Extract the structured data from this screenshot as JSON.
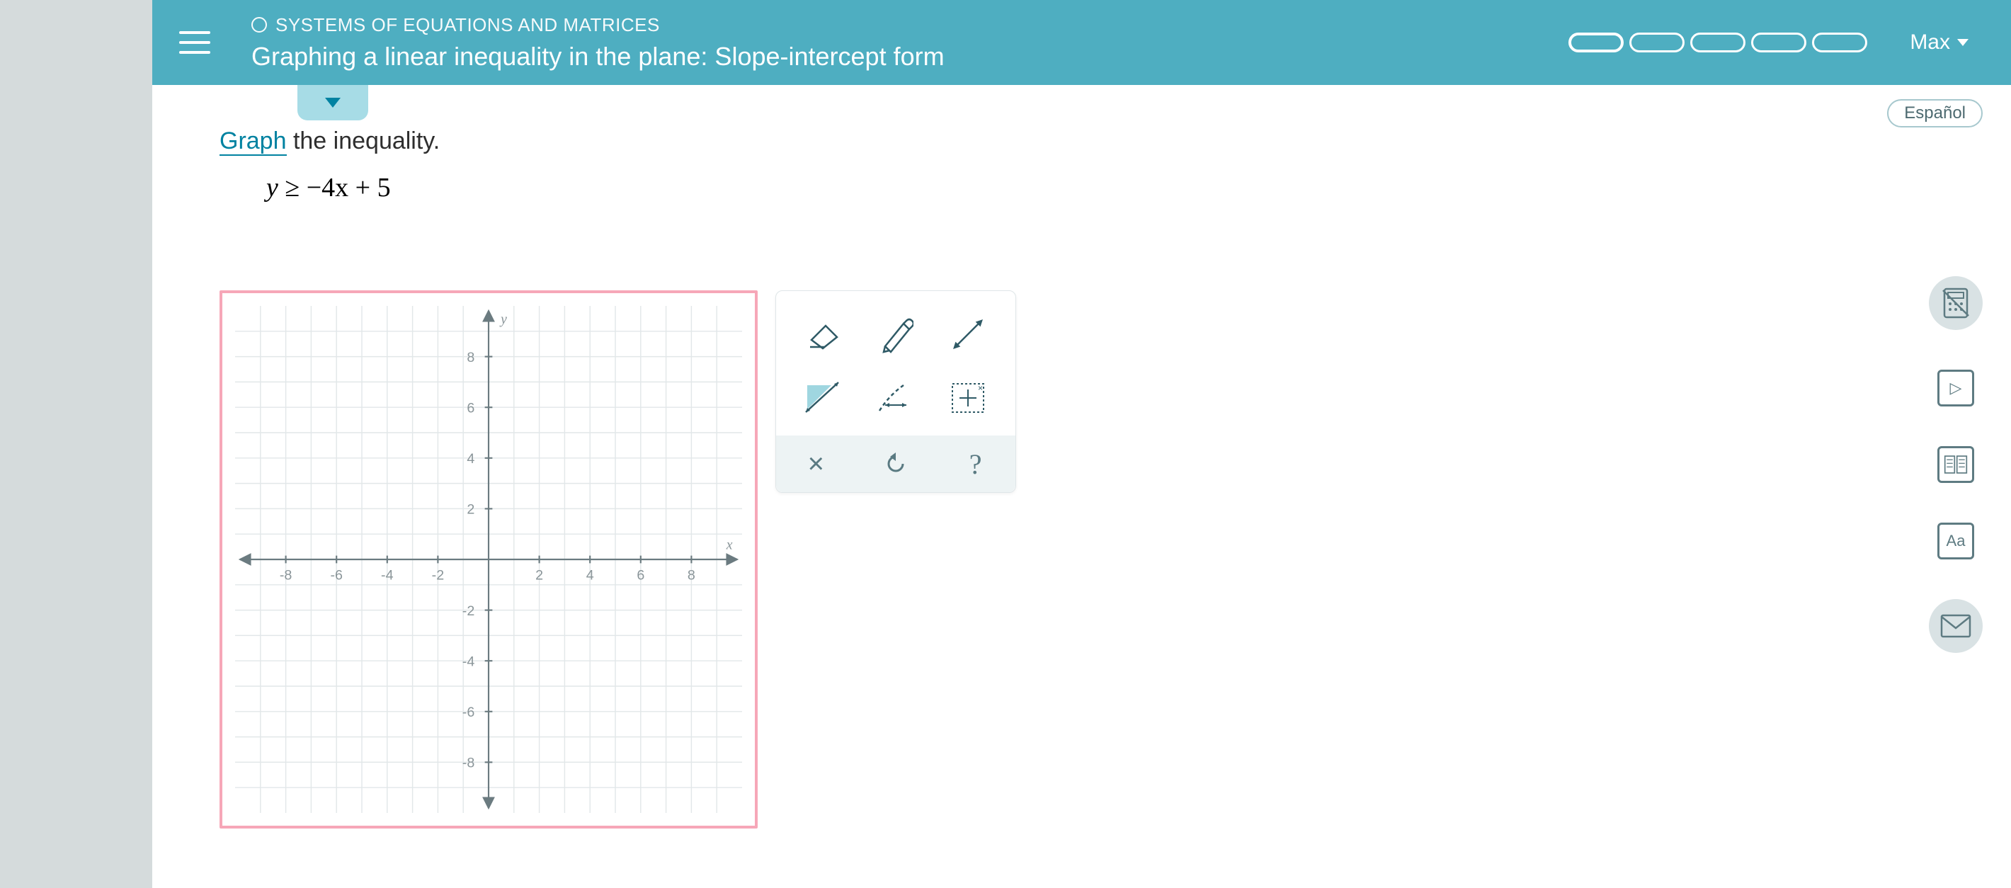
{
  "header": {
    "breadcrumb": "SYSTEMS OF EQUATIONS AND MATRICES",
    "topic": "Graphing a linear inequality in the plane: Slope-intercept form",
    "user": "Max"
  },
  "lang_button": "Español",
  "question": {
    "link_text": "Graph",
    "instruction_rest": " the inequality.",
    "formula_y": "y",
    "formula_rest": " ≥ −4x + 5"
  },
  "chart_data": {
    "type": "scatter",
    "title": "",
    "xlabel": "x",
    "ylabel": "y",
    "xlim": [
      -10,
      10
    ],
    "ylim": [
      -10,
      10
    ],
    "xticks": [
      -8,
      -6,
      -4,
      -2,
      2,
      4,
      6,
      8
    ],
    "yticks": [
      -8,
      -6,
      -4,
      -2,
      2,
      4,
      6,
      8
    ],
    "series": []
  },
  "tools": {
    "eraser": "eraser",
    "pencil": "pencil",
    "line": "line",
    "region_solid": "shade-solid-line",
    "region_dashed": "shade-dashed-line",
    "grid_point": "grid-point",
    "clear": "×",
    "undo": "↺",
    "help": "?"
  },
  "side": {
    "calculator": "calculator",
    "play": "▷",
    "reference": "reference",
    "text_size": "Aa",
    "message": "message"
  }
}
